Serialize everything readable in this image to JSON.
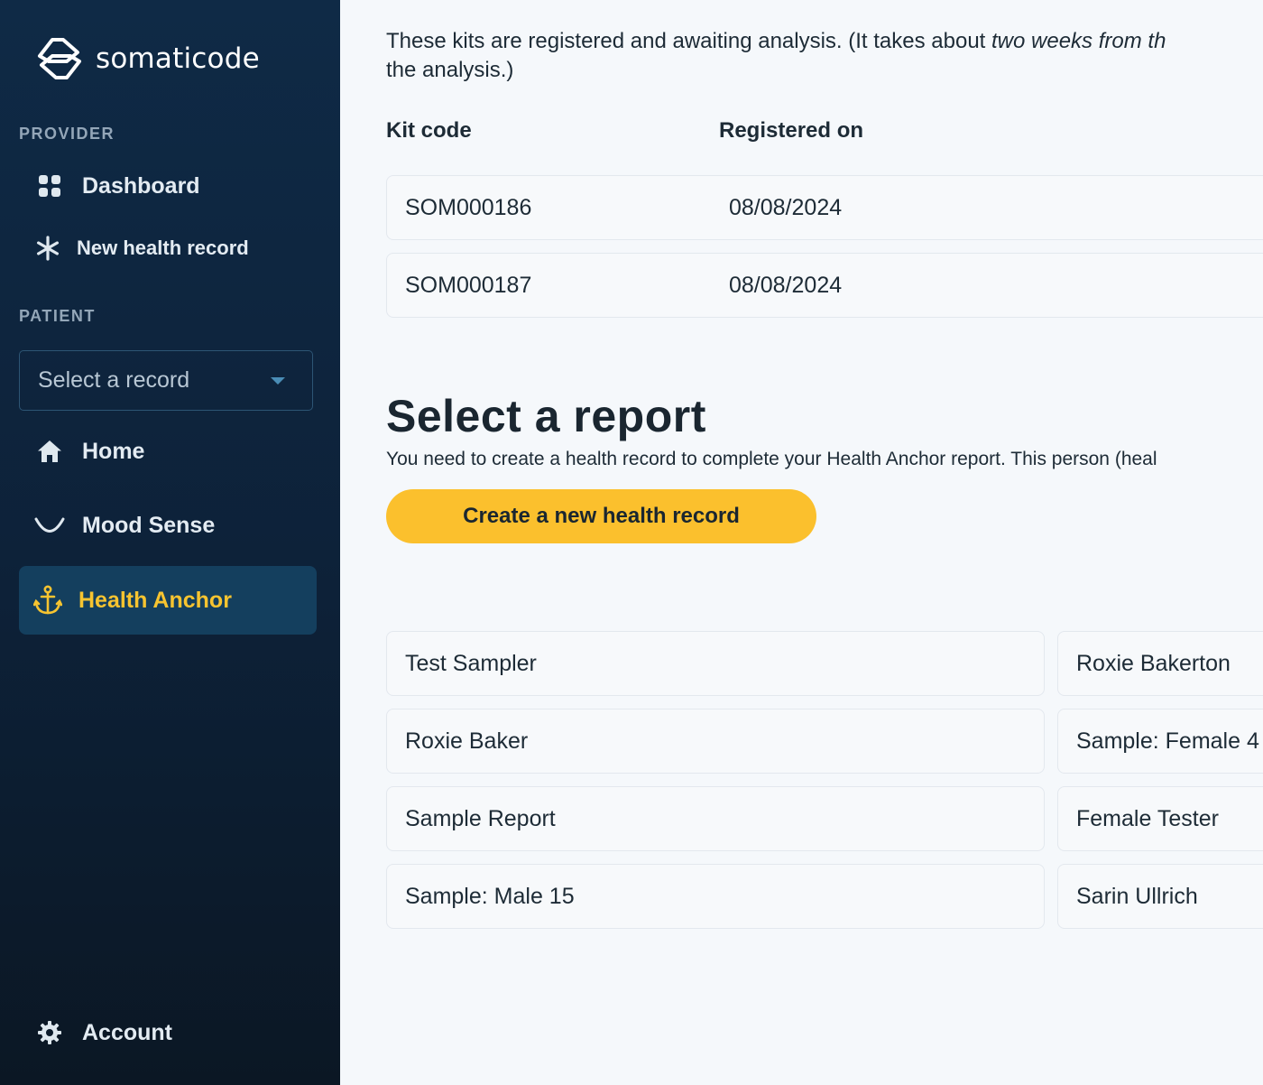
{
  "brand": {
    "name": "somaticode"
  },
  "sidebar": {
    "provider_label": "PROVIDER",
    "provider_items": [
      {
        "label": "Dashboard",
        "icon": "grid-icon"
      },
      {
        "label": "New health record",
        "icon": "asterisk-icon"
      }
    ],
    "patient_label": "PATIENT",
    "record_select": {
      "value": "Select a record"
    },
    "patient_items": [
      {
        "label": "Home",
        "icon": "home-icon"
      },
      {
        "label": "Mood Sense",
        "icon": "smile-icon"
      },
      {
        "label": "Health Anchor",
        "icon": "anchor-icon",
        "active": true
      }
    ],
    "account": {
      "label": "Account",
      "icon": "gear-icon"
    }
  },
  "kits": {
    "intro_before": "These kits are registered and awaiting analysis. (It takes about ",
    "intro_emphasis": "two weeks from th",
    "intro_after": "the analysis.)",
    "columns": [
      "Kit code",
      "Registered on"
    ],
    "rows": [
      {
        "code": "SOM000186",
        "date": "08/08/2024"
      },
      {
        "code": "SOM000187",
        "date": "08/08/2024"
      }
    ]
  },
  "reports": {
    "title": "Select a report",
    "subtitle": "You need to create a health record to complete your Health Anchor report. This person (heal",
    "create_button": "Create a new health record",
    "items": [
      "Test Sampler",
      "Roxie Bakerton",
      "Roxie Baker",
      "Sample: Female 4",
      "Sample Report",
      "Female Tester",
      "Sample: Male 15",
      "Sarin Ullrich"
    ]
  },
  "colors": {
    "sidebar_bg": "#0f2a46",
    "accent_yellow": "#fbc02d",
    "active_item_bg": "#143f5e",
    "active_text": "#f7c430"
  }
}
